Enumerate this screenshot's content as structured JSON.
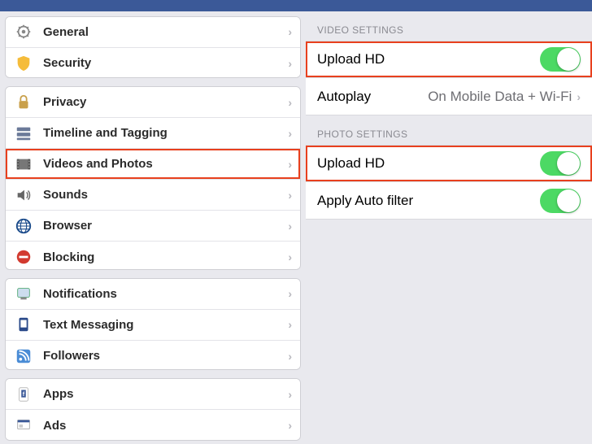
{
  "settings": {
    "groups": [
      [
        {
          "key": "general",
          "label": "General"
        },
        {
          "key": "security",
          "label": "Security"
        }
      ],
      [
        {
          "key": "privacy",
          "label": "Privacy"
        },
        {
          "key": "timeline",
          "label": "Timeline and Tagging"
        },
        {
          "key": "videos-photos",
          "label": "Videos and Photos",
          "highlighted": true
        },
        {
          "key": "sounds",
          "label": "Sounds"
        },
        {
          "key": "browser",
          "label": "Browser"
        },
        {
          "key": "blocking",
          "label": "Blocking"
        }
      ],
      [
        {
          "key": "notifications",
          "label": "Notifications"
        },
        {
          "key": "text-messaging",
          "label": "Text Messaging"
        },
        {
          "key": "followers",
          "label": "Followers"
        }
      ],
      [
        {
          "key": "apps",
          "label": "Apps"
        },
        {
          "key": "ads",
          "label": "Ads"
        }
      ]
    ]
  },
  "video_section": {
    "header": "VIDEO SETTINGS",
    "upload_hd": {
      "label": "Upload HD",
      "on": true,
      "highlighted": true
    },
    "autoplay": {
      "label": "Autoplay",
      "value": "On Mobile Data + Wi-Fi"
    }
  },
  "photo_section": {
    "header": "PHOTO SETTINGS",
    "upload_hd": {
      "label": "Upload HD",
      "on": true,
      "highlighted": true
    },
    "auto_filter": {
      "label": "Apply Auto filter",
      "on": true
    }
  },
  "colors": {
    "brand": "#3b5998",
    "accent": "#4cd964",
    "highlight": "#e8401e"
  }
}
